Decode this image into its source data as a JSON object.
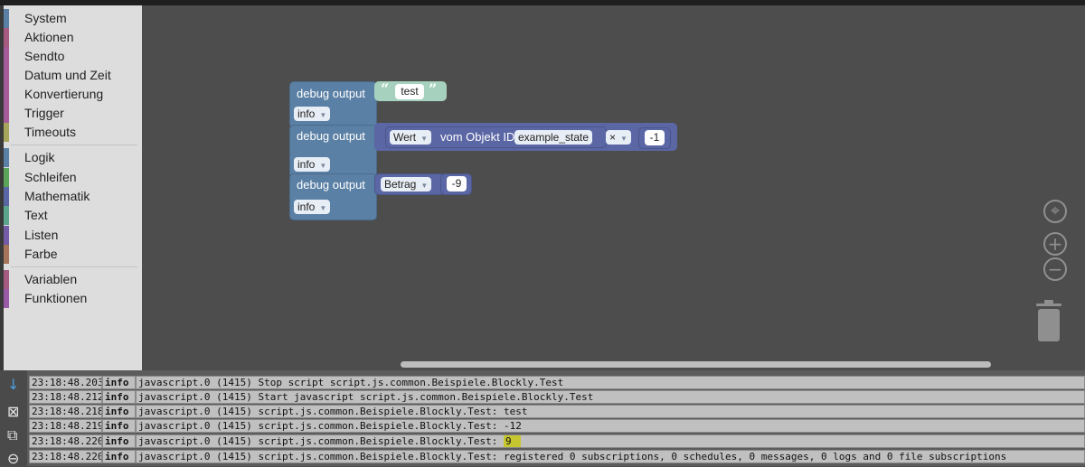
{
  "toolbox": {
    "categories": [
      {
        "label": "System",
        "color": "#5b80a5"
      },
      {
        "label": "Aktionen",
        "color": "#a55b80"
      },
      {
        "label": "Sendto",
        "color": "#a55b99"
      },
      {
        "label": "Datum und Zeit",
        "color": "#a55b99"
      },
      {
        "label": "Konvertierung",
        "color": "#a55b99"
      },
      {
        "label": "Trigger",
        "color": "#a55b99"
      },
      {
        "label": "Timeouts",
        "color": "#a5a55b"
      },
      {
        "label": "Logik",
        "color": "#5b80a5"
      },
      {
        "label": "Schleifen",
        "color": "#5ba55b"
      },
      {
        "label": "Mathematik",
        "color": "#5b67a5"
      },
      {
        "label": "Text",
        "color": "#5ba58c"
      },
      {
        "label": "Listen",
        "color": "#745ba5"
      },
      {
        "label": "Farbe",
        "color": "#a5745b"
      },
      {
        "label": "Variablen",
        "color": "#a55b80"
      },
      {
        "label": "Funktionen",
        "color": "#995ba5"
      }
    ]
  },
  "blocks": {
    "debug1": {
      "label": "debug output",
      "level": "info",
      "string_value": "test",
      "open_quote": "“",
      "close_quote": "”"
    },
    "debug2": {
      "label": "debug output",
      "level": "info",
      "get_attr": "Wert",
      "get_text": "vom Objekt ID",
      "object_id": "example_state",
      "op": "×",
      "operand": "-1"
    },
    "debug3": {
      "label": "debug output",
      "level": "info",
      "func": "Betrag",
      "value": "-9"
    },
    "dropdown_arrow": "▼"
  },
  "controls": {
    "center_icon": "target-icon",
    "zoom_in": "+",
    "zoom_out": "−",
    "trash_icon": "trash-icon"
  },
  "log": {
    "side_icons": {
      "scroll": "↓",
      "clear": "⊠",
      "copy": "⧉",
      "stop": "⊖"
    },
    "rows": [
      {
        "time": "23:18:48.203",
        "severity": "info",
        "message": "javascript.0 (1415) Stop script script.js.common.Beispiele.Blockly.Test"
      },
      {
        "time": "23:18:48.212",
        "severity": "info",
        "message": "javascript.0 (1415) Start javascript script.js.common.Beispiele.Blockly.Test"
      },
      {
        "time": "23:18:48.218",
        "severity": "info",
        "message": "javascript.0 (1415) script.js.common.Beispiele.Blockly.Test: test"
      },
      {
        "time": "23:18:48.219",
        "severity": "info",
        "message": "javascript.0 (1415) script.js.common.Beispiele.Blockly.Test: -12"
      },
      {
        "time": "23:18:48.220",
        "severity": "info",
        "message": "javascript.0 (1415) script.js.common.Beispiele.Blockly.Test: ",
        "highlight": "9"
      },
      {
        "time": "23:18:48.220",
        "severity": "info",
        "message": "javascript.0 (1415) script.js.common.Beispiele.Blockly.Test: registered 0 subscriptions, 0 schedules, 0 messages, 0 logs and 0 file subscriptions"
      }
    ]
  }
}
